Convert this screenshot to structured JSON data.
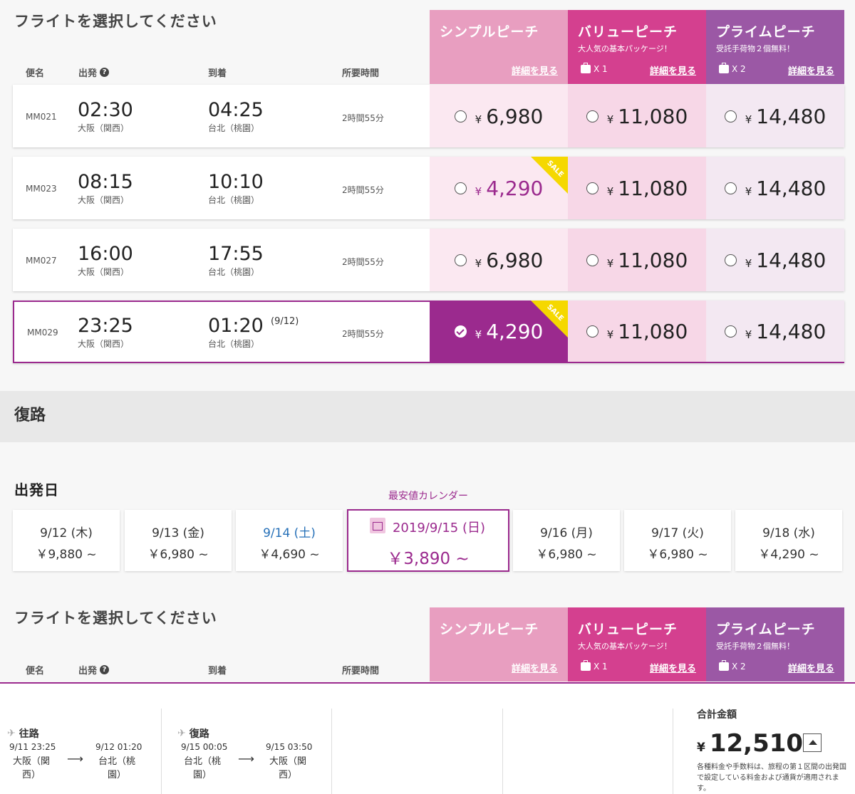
{
  "outbound": {
    "title": "フライトを選択してください",
    "columns": {
      "flight": "便名",
      "depart": "出発",
      "arrive": "到着",
      "duration": "所要時間"
    },
    "fares": [
      {
        "name": "シンプルピーチ",
        "sub": "",
        "bag": "",
        "detail": "詳細を見る",
        "color": "#e89ec0"
      },
      {
        "name": "バリューピーチ",
        "sub": "大人気の基本パッケージ！",
        "bag": "X 1",
        "detail": "詳細を見る",
        "color": "#d4408f"
      },
      {
        "name": "プライムピーチ",
        "sub": "受託手荷物２個無料！",
        "bag": "X 2",
        "detail": "詳細を見る",
        "color": "#9b58a5"
      }
    ],
    "flights": [
      {
        "no": "MM021",
        "dep_time": "02:30",
        "dep_place": "大阪（関西）",
        "arr_time": "04:25",
        "arr_place": "台北（桃園）",
        "next_day": "",
        "duration": "2時間55分",
        "prices": [
          "6,980",
          "11,080",
          "14,480"
        ],
        "sale": false,
        "selected": false
      },
      {
        "no": "MM023",
        "dep_time": "08:15",
        "dep_place": "大阪（関西）",
        "arr_time": "10:10",
        "arr_place": "台北（桃園）",
        "next_day": "",
        "duration": "2時間55分",
        "prices": [
          "4,290",
          "11,080",
          "14,480"
        ],
        "sale": true,
        "selected": false
      },
      {
        "no": "MM027",
        "dep_time": "16:00",
        "dep_place": "大阪（関西）",
        "arr_time": "17:55",
        "arr_place": "台北（桃園）",
        "next_day": "",
        "duration": "2時間55分",
        "prices": [
          "6,980",
          "11,080",
          "14,480"
        ],
        "sale": false,
        "selected": false
      },
      {
        "no": "MM029",
        "dep_time": "23:25",
        "dep_place": "大阪（関西）",
        "arr_time": "01:20",
        "arr_place": "台北（桃園）",
        "next_day": "(9/12)",
        "duration": "2時間55分",
        "prices": [
          "4,290",
          "11,080",
          "14,480"
        ],
        "sale": true,
        "selected": true
      }
    ],
    "currency": "¥",
    "sale_label": "SALE"
  },
  "return_section": {
    "title": "復路",
    "date_title": "出発日",
    "calendar_label": "最安値カレンダー",
    "dates": [
      {
        "date": "9/12 (木)",
        "price": "￥9,880 ~"
      },
      {
        "date": "9/13 (金)",
        "price": "￥6,980 ~"
      },
      {
        "date": "9/14 (土)",
        "price": "￥4,690 ~"
      },
      {
        "date": "2019/9/15 (日)",
        "price": "￥3,890 ~"
      },
      {
        "date": "9/16 (月)",
        "price": "￥6,980 ~"
      },
      {
        "date": "9/17 (火)",
        "price": "￥6,980 ~"
      },
      {
        "date": "9/18 (水)",
        "price": "￥4,290 ~"
      }
    ],
    "flight_title": "フライトを選択してください"
  },
  "summary": {
    "outbound": {
      "label": "往路",
      "dep_time": "9/11 23:25",
      "dep_place": "大阪（関西）",
      "arr_time": "9/12 01:20",
      "arr_place": "台北（桃園）"
    },
    "inbound": {
      "label": "復路",
      "dep_time": "9/15 00:05",
      "dep_place": "台北（桃園）",
      "arr_time": "9/15 03:50",
      "arr_place": "大阪（関西）"
    },
    "total_label": "合計金額",
    "total_currency": "¥",
    "total_amount": "12,510",
    "note": "各種料金や手数料は、旅程の第１区間の出発国で設定している料金および通貨が適用されます。"
  }
}
